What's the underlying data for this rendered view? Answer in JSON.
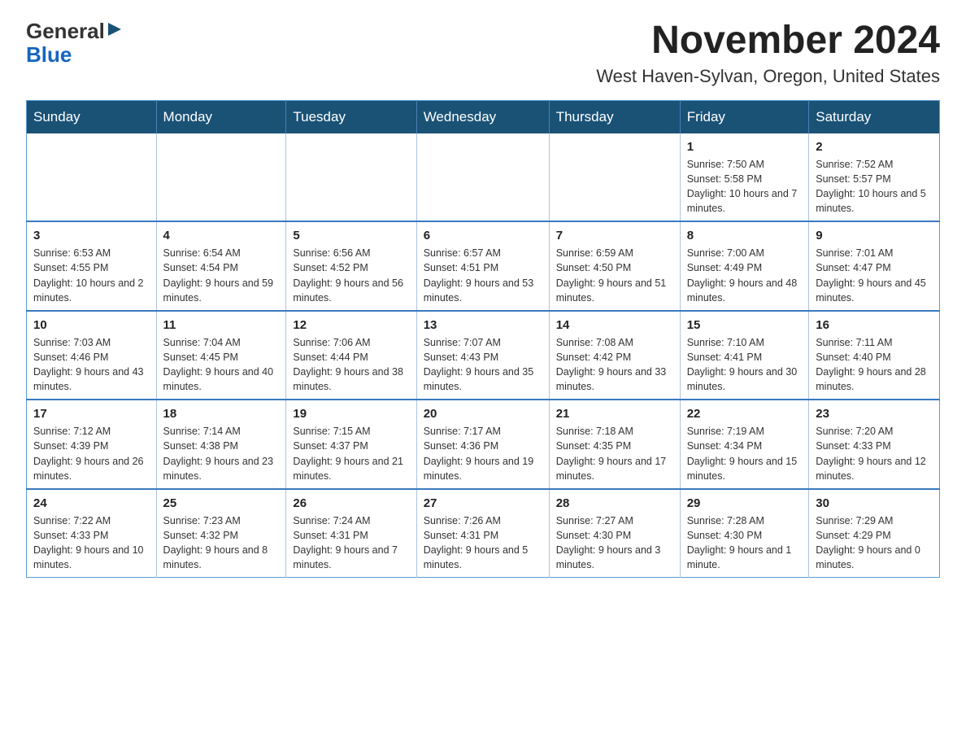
{
  "logo": {
    "general": "General",
    "blue": "Blue",
    "tagline": ""
  },
  "header": {
    "title": "November 2024",
    "subtitle": "West Haven-Sylvan, Oregon, United States"
  },
  "weekdays": [
    "Sunday",
    "Monday",
    "Tuesday",
    "Wednesday",
    "Thursday",
    "Friday",
    "Saturday"
  ],
  "weeks": [
    [
      {
        "day": "",
        "info": ""
      },
      {
        "day": "",
        "info": ""
      },
      {
        "day": "",
        "info": ""
      },
      {
        "day": "",
        "info": ""
      },
      {
        "day": "",
        "info": ""
      },
      {
        "day": "1",
        "info": "Sunrise: 7:50 AM\nSunset: 5:58 PM\nDaylight: 10 hours and 7 minutes."
      },
      {
        "day": "2",
        "info": "Sunrise: 7:52 AM\nSunset: 5:57 PM\nDaylight: 10 hours and 5 minutes."
      }
    ],
    [
      {
        "day": "3",
        "info": "Sunrise: 6:53 AM\nSunset: 4:55 PM\nDaylight: 10 hours and 2 minutes."
      },
      {
        "day": "4",
        "info": "Sunrise: 6:54 AM\nSunset: 4:54 PM\nDaylight: 9 hours and 59 minutes."
      },
      {
        "day": "5",
        "info": "Sunrise: 6:56 AM\nSunset: 4:52 PM\nDaylight: 9 hours and 56 minutes."
      },
      {
        "day": "6",
        "info": "Sunrise: 6:57 AM\nSunset: 4:51 PM\nDaylight: 9 hours and 53 minutes."
      },
      {
        "day": "7",
        "info": "Sunrise: 6:59 AM\nSunset: 4:50 PM\nDaylight: 9 hours and 51 minutes."
      },
      {
        "day": "8",
        "info": "Sunrise: 7:00 AM\nSunset: 4:49 PM\nDaylight: 9 hours and 48 minutes."
      },
      {
        "day": "9",
        "info": "Sunrise: 7:01 AM\nSunset: 4:47 PM\nDaylight: 9 hours and 45 minutes."
      }
    ],
    [
      {
        "day": "10",
        "info": "Sunrise: 7:03 AM\nSunset: 4:46 PM\nDaylight: 9 hours and 43 minutes."
      },
      {
        "day": "11",
        "info": "Sunrise: 7:04 AM\nSunset: 4:45 PM\nDaylight: 9 hours and 40 minutes."
      },
      {
        "day": "12",
        "info": "Sunrise: 7:06 AM\nSunset: 4:44 PM\nDaylight: 9 hours and 38 minutes."
      },
      {
        "day": "13",
        "info": "Sunrise: 7:07 AM\nSunset: 4:43 PM\nDaylight: 9 hours and 35 minutes."
      },
      {
        "day": "14",
        "info": "Sunrise: 7:08 AM\nSunset: 4:42 PM\nDaylight: 9 hours and 33 minutes."
      },
      {
        "day": "15",
        "info": "Sunrise: 7:10 AM\nSunset: 4:41 PM\nDaylight: 9 hours and 30 minutes."
      },
      {
        "day": "16",
        "info": "Sunrise: 7:11 AM\nSunset: 4:40 PM\nDaylight: 9 hours and 28 minutes."
      }
    ],
    [
      {
        "day": "17",
        "info": "Sunrise: 7:12 AM\nSunset: 4:39 PM\nDaylight: 9 hours and 26 minutes."
      },
      {
        "day": "18",
        "info": "Sunrise: 7:14 AM\nSunset: 4:38 PM\nDaylight: 9 hours and 23 minutes."
      },
      {
        "day": "19",
        "info": "Sunrise: 7:15 AM\nSunset: 4:37 PM\nDaylight: 9 hours and 21 minutes."
      },
      {
        "day": "20",
        "info": "Sunrise: 7:17 AM\nSunset: 4:36 PM\nDaylight: 9 hours and 19 minutes."
      },
      {
        "day": "21",
        "info": "Sunrise: 7:18 AM\nSunset: 4:35 PM\nDaylight: 9 hours and 17 minutes."
      },
      {
        "day": "22",
        "info": "Sunrise: 7:19 AM\nSunset: 4:34 PM\nDaylight: 9 hours and 15 minutes."
      },
      {
        "day": "23",
        "info": "Sunrise: 7:20 AM\nSunset: 4:33 PM\nDaylight: 9 hours and 12 minutes."
      }
    ],
    [
      {
        "day": "24",
        "info": "Sunrise: 7:22 AM\nSunset: 4:33 PM\nDaylight: 9 hours and 10 minutes."
      },
      {
        "day": "25",
        "info": "Sunrise: 7:23 AM\nSunset: 4:32 PM\nDaylight: 9 hours and 8 minutes."
      },
      {
        "day": "26",
        "info": "Sunrise: 7:24 AM\nSunset: 4:31 PM\nDaylight: 9 hours and 7 minutes."
      },
      {
        "day": "27",
        "info": "Sunrise: 7:26 AM\nSunset: 4:31 PM\nDaylight: 9 hours and 5 minutes."
      },
      {
        "day": "28",
        "info": "Sunrise: 7:27 AM\nSunset: 4:30 PM\nDaylight: 9 hours and 3 minutes."
      },
      {
        "day": "29",
        "info": "Sunrise: 7:28 AM\nSunset: 4:30 PM\nDaylight: 9 hours and 1 minute."
      },
      {
        "day": "30",
        "info": "Sunrise: 7:29 AM\nSunset: 4:29 PM\nDaylight: 9 hours and 0 minutes."
      }
    ]
  ]
}
